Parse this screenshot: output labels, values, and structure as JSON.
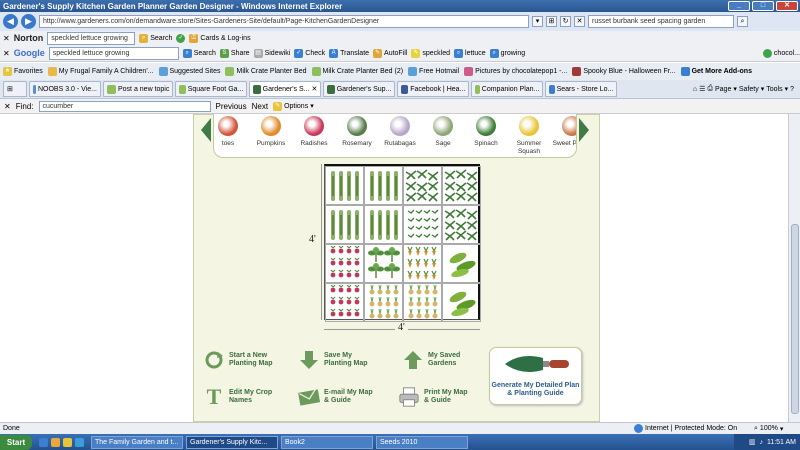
{
  "window": {
    "title": "Gardener's Supply Kitchen Garden Planner Garden Designer - Windows Internet Explorer"
  },
  "address": {
    "url": "http://www.gardeners.com/on/demandware.store/Sites-Gardeners-Site/default/Page-KitchenGardenDesigner",
    "search_value": "russet burbank seed spacing garden"
  },
  "norton": {
    "brand": "Norton",
    "search_value": "speckled lettuce growing",
    "search_label": "Search",
    "cards_label": "Cards & Log-ins"
  },
  "google": {
    "brand": "Google",
    "search_value": "speckled lettuce growing",
    "items": [
      "Search",
      "Share",
      "Sidewiki",
      "Check",
      "Translate",
      "AutoFill",
      "speckled",
      "lettuce",
      "growing"
    ],
    "signin": "chocol..."
  },
  "favorites": {
    "label": "Favorites",
    "items": [
      "My Frugal Family A Children'...",
      "Suggested Sites",
      "Milk Crate Planter Bed",
      "Milk Crate Planter Bed (2)",
      "Free Hotmail",
      "Pictures by chocolatepop1 -...",
      "Spooky Blue - Halloween Fr...",
      "Get More Add-ons"
    ]
  },
  "tabs": [
    {
      "label": "NOOBS 3.0 - Vie..."
    },
    {
      "label": "Post a new topic"
    },
    {
      "label": "Square Foot Ga..."
    },
    {
      "label": "Gardener's S..."
    },
    {
      "label": "Gardener's Sup..."
    },
    {
      "label": "Facebook | Hea..."
    },
    {
      "label": "Companion Plan..."
    },
    {
      "label": "Sears - Store Lo..."
    }
  ],
  "commands": {
    "page": "Page",
    "safety": "Safety",
    "tools": "Tools"
  },
  "find": {
    "label": "Find:",
    "value": "cucumber",
    "previous": "Previous",
    "next": "Next",
    "options": "Options"
  },
  "planner": {
    "vegetables": [
      {
        "name": "toes",
        "color": "#d2543a"
      },
      {
        "name": "Pumpkins",
        "color": "#e08a2b"
      },
      {
        "name": "Radishes",
        "color": "#c83a5a"
      },
      {
        "name": "Rosemary",
        "color": "#5a7d4a"
      },
      {
        "name": "Rutabagas",
        "color": "#b8a6c9"
      },
      {
        "name": "Sage",
        "color": "#8fa678"
      },
      {
        "name": "Spinach",
        "color": "#3e7f3a"
      },
      {
        "name": "Summer Squash",
        "color": "#e8c43a"
      },
      {
        "name": "Sweet Potato",
        "color": "#c87a4a"
      }
    ],
    "grid_rows": [
      [
        "beans",
        "beans",
        "pea",
        "pea"
      ],
      [
        "beans",
        "beans",
        "pea-small",
        "pea"
      ],
      [
        "radish",
        "herb",
        "carrot",
        "cucumber"
      ],
      [
        "radish",
        "onion",
        "onion",
        "cucumber"
      ]
    ],
    "dimension_side": "4'",
    "dimension_bottom": "4'",
    "actions": {
      "start_new": "Start a New Planting Map",
      "save": "Save My Planting Map",
      "my_saved": "My Saved Gardens",
      "edit_names": "Edit My Crop Names",
      "email": "E-mail My Map & Guide",
      "print": "Print My Map & Guide",
      "generate": "Generate My Detailed Plan & Planting Guide"
    },
    "colors": {
      "green": "#3b6d3f",
      "blue": "#2d5d8c"
    }
  },
  "status": {
    "left": "Done",
    "zone": "Internet | Protected Mode: On",
    "zoom": "100%"
  },
  "taskbar": {
    "start": "Start",
    "buttons": [
      "The Family Garden and t...",
      "Gardener's Supply Kitc...",
      "Book2",
      "Seeds 2010"
    ],
    "clock": "11:51 AM"
  }
}
